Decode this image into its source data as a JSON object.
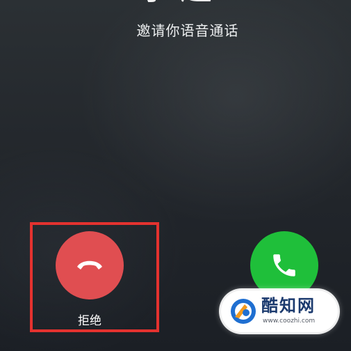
{
  "call": {
    "caller_name_partial": "小 趣",
    "subtitle": "邀请你语音通话"
  },
  "actions": {
    "decline_label": "拒绝",
    "decline_color": "#e04e51",
    "accept_color": "#1fbf3a",
    "highlight_color": "#e4322f"
  },
  "watermark": {
    "title": "酷知网",
    "url": "www.coozhi.com"
  },
  "icons": {
    "decline": "hang-up-phone-icon",
    "accept": "phone-handset-icon",
    "watermark_logo": "coozhi-logo-icon"
  }
}
